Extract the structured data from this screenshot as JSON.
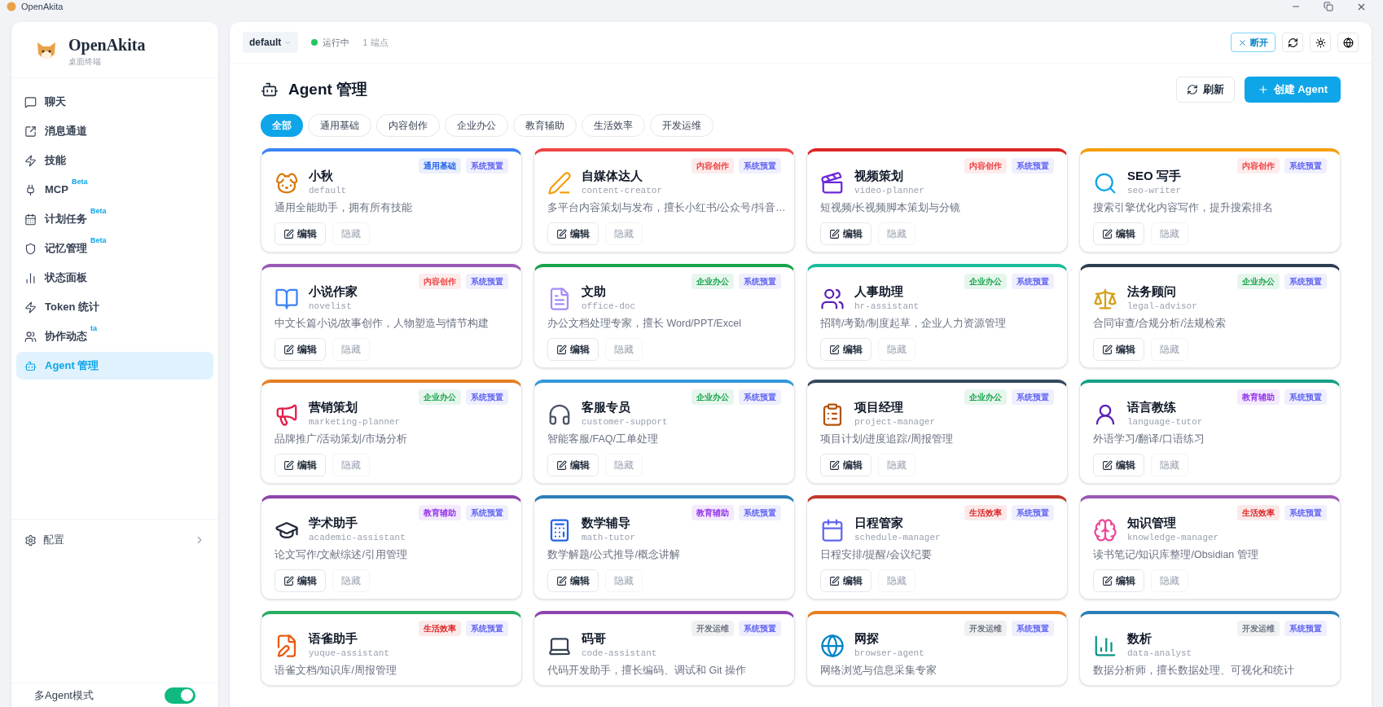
{
  "window": {
    "title": "OpenAkita"
  },
  "sidebar": {
    "brand": "OpenAkita",
    "subtitle": "桌面终端",
    "items": [
      {
        "label": "聊天",
        "selected": false
      },
      {
        "label": "消息通道",
        "selected": false
      },
      {
        "label": "技能",
        "selected": false
      },
      {
        "label": "MCP",
        "badge": "Beta",
        "selected": false
      },
      {
        "label": "计划任务",
        "badge": "Beta",
        "selected": false
      },
      {
        "label": "记忆管理",
        "badge": "Beta",
        "selected": false
      },
      {
        "label": "状态面板",
        "selected": false
      },
      {
        "label": "Token 统计",
        "selected": false
      },
      {
        "label": "协作动态",
        "badge": "ta",
        "selected": false
      },
      {
        "label": "Agent 管理",
        "selected": true
      }
    ],
    "config": {
      "label": "配置"
    },
    "multi_agent": {
      "label": "多Agent模式",
      "on": true
    }
  },
  "top_bar": {
    "profile": "default",
    "status": "运行中",
    "endpoints": "1 端点",
    "disconnect": "断开"
  },
  "header": {
    "title": "Agent 管理",
    "refresh": "刷新",
    "create": "创建 Agent"
  },
  "filters": [
    {
      "label": "全部",
      "selected": true
    },
    {
      "label": "通用基础",
      "selected": false
    },
    {
      "label": "内容创作",
      "selected": false
    },
    {
      "label": "企业办公",
      "selected": false
    },
    {
      "label": "教育辅助",
      "selected": false
    },
    {
      "label": "生活效率",
      "selected": false
    },
    {
      "label": "开发运维",
      "selected": false
    }
  ],
  "agents": [
    {
      "name": "小秋",
      "id": "default",
      "description": "通用全能助手，拥有所有技能",
      "color": "#3b82f6",
      "tags": [
        {
          "label": "通用基础",
          "color": "#2563eb"
        },
        {
          "label": "系统预置",
          "color": "#6366f1"
        }
      ],
      "edit": "编辑",
      "hide": "隐藏"
    },
    {
      "name": "自媒体达人",
      "id": "content-creator",
      "description": "多平台内容策划与发布，擅长小红书/公众号/抖音…",
      "color": "#ef4444",
      "tags": [
        {
          "label": "内容创作",
          "color": "#ef4444"
        },
        {
          "label": "系统预置",
          "color": "#6366f1"
        }
      ],
      "edit": "编辑",
      "hide": "隐藏"
    },
    {
      "name": "视频策划",
      "id": "video-planner",
      "description": "短视频/长视频脚本策划与分镜",
      "color": "#dc2626",
      "tags": [
        {
          "label": "内容创作",
          "color": "#ef4444"
        },
        {
          "label": "系统预置",
          "color": "#6366f1"
        }
      ],
      "edit": "编辑",
      "hide": "隐藏"
    },
    {
      "name": "SEO 写手",
      "id": "seo-writer",
      "description": "搜索引擎优化内容写作，提升搜索排名",
      "color": "#f59e0b",
      "tags": [
        {
          "label": "内容创作",
          "color": "#ef4444"
        },
        {
          "label": "系统预置",
          "color": "#6366f1"
        }
      ],
      "edit": "编辑",
      "hide": "隐藏"
    },
    {
      "name": "小说作家",
      "id": "novelist",
      "description": "中文长篇小说/故事创作，人物塑造与情节构建",
      "color": "#9b59b6",
      "tags": [
        {
          "label": "内容创作",
          "color": "#ef4444"
        },
        {
          "label": "系统预置",
          "color": "#6366f1"
        }
      ],
      "edit": "编辑",
      "hide": "隐藏"
    },
    {
      "name": "文助",
      "id": "office-doc",
      "description": "办公文档处理专家，擅长 Word/PPT/Excel",
      "color": "#16a34a",
      "tags": [
        {
          "label": "企业办公",
          "color": "#16a34a"
        },
        {
          "label": "系统预置",
          "color": "#6366f1"
        }
      ],
      "edit": "编辑",
      "hide": "隐藏"
    },
    {
      "name": "人事助理",
      "id": "hr-assistant",
      "description": "招聘/考勤/制度起草，企业人力资源管理",
      "color": "#1abc9c",
      "tags": [
        {
          "label": "企业办公",
          "color": "#16a34a"
        },
        {
          "label": "系统预置",
          "color": "#6366f1"
        }
      ],
      "edit": "编辑",
      "hide": "隐藏"
    },
    {
      "name": "法务顾问",
      "id": "legal-advisor",
      "description": "合同审查/合规分析/法规检索",
      "color": "#2c3e50",
      "tags": [
        {
          "label": "企业办公",
          "color": "#16a34a"
        },
        {
          "label": "系统预置",
          "color": "#6366f1"
        }
      ],
      "edit": "编辑",
      "hide": "隐藏"
    },
    {
      "name": "营销策划",
      "id": "marketing-planner",
      "description": "品牌推广/活动策划/市场分析",
      "color": "#e67e22",
      "tags": [
        {
          "label": "企业办公",
          "color": "#16a34a"
        },
        {
          "label": "系统预置",
          "color": "#6366f1"
        }
      ],
      "edit": "编辑",
      "hide": "隐藏"
    },
    {
      "name": "客服专员",
      "id": "customer-support",
      "description": "智能客服/FAQ/工单处理",
      "color": "#3498db",
      "tags": [
        {
          "label": "企业办公",
          "color": "#16a34a"
        },
        {
          "label": "系统预置",
          "color": "#6366f1"
        }
      ],
      "edit": "编辑",
      "hide": "隐藏"
    },
    {
      "name": "项目经理",
      "id": "project-manager",
      "description": "项目计划/进度追踪/周报管理",
      "color": "#34495e",
      "tags": [
        {
          "label": "企业办公",
          "color": "#16a34a"
        },
        {
          "label": "系统预置",
          "color": "#6366f1"
        }
      ],
      "edit": "编辑",
      "hide": "隐藏"
    },
    {
      "name": "语言教练",
      "id": "language-tutor",
      "description": "外语学习/翻译/口语练习",
      "color": "#16a085",
      "tags": [
        {
          "label": "教育辅助",
          "color": "#9333ea"
        },
        {
          "label": "系统预置",
          "color": "#6366f1"
        }
      ],
      "edit": "编辑",
      "hide": "隐藏"
    },
    {
      "name": "学术助手",
      "id": "academic-assistant",
      "description": "论文写作/文献综述/引用管理",
      "color": "#8e44ad",
      "tags": [
        {
          "label": "教育辅助",
          "color": "#9333ea"
        },
        {
          "label": "系统预置",
          "color": "#6366f1"
        }
      ],
      "edit": "编辑",
      "hide": "隐藏"
    },
    {
      "name": "数学辅导",
      "id": "math-tutor",
      "description": "数学解题/公式推导/概念讲解",
      "color": "#2980b9",
      "tags": [
        {
          "label": "教育辅助",
          "color": "#9333ea"
        },
        {
          "label": "系统预置",
          "color": "#6366f1"
        }
      ],
      "edit": "编辑",
      "hide": "隐藏"
    },
    {
      "name": "日程管家",
      "id": "schedule-manager",
      "description": "日程安排/提醒/会议纪要",
      "color": "#c0392b",
      "tags": [
        {
          "label": "生活效率",
          "color": "#dc2626"
        },
        {
          "label": "系统预置",
          "color": "#6366f1"
        }
      ],
      "edit": "编辑",
      "hide": "隐藏"
    },
    {
      "name": "知识管理",
      "id": "knowledge-manager",
      "description": "读书笔记/知识库整理/Obsidian 管理",
      "color": "#9b59b6",
      "tags": [
        {
          "label": "生活效率",
          "color": "#dc2626"
        },
        {
          "label": "系统预置",
          "color": "#6366f1"
        }
      ],
      "edit": "编辑",
      "hide": "隐藏"
    },
    {
      "name": "语雀助手",
      "id": "yuque-assistant",
      "description": "语雀文档/知识库/周报管理",
      "color": "#27ae60",
      "tags": [
        {
          "label": "生活效率",
          "color": "#dc2626"
        },
        {
          "label": "系统预置",
          "color": "#6366f1"
        }
      ]
    },
    {
      "name": "码哥",
      "id": "code-assistant",
      "description": "代码开发助手，擅长编码、调试和 Git 操作",
      "color": "#8e44ad",
      "tags": [
        {
          "label": "开发运维",
          "color": "#6b7280"
        },
        {
          "label": "系统预置",
          "color": "#6366f1"
        }
      ]
    },
    {
      "name": "网探",
      "id": "browser-agent",
      "description": "网络浏览与信息采集专家",
      "color": "#e67e22",
      "tags": [
        {
          "label": "开发运维",
          "color": "#6b7280"
        },
        {
          "label": "系统预置",
          "color": "#6366f1"
        }
      ]
    },
    {
      "name": "数析",
      "id": "data-analyst",
      "description": "数据分析师，擅长数据处理、可视化和统计",
      "color": "#2980b9",
      "tags": [
        {
          "label": "开发运维",
          "color": "#6b7280"
        },
        {
          "label": "系统预置",
          "color": "#6366f1"
        }
      ]
    }
  ]
}
